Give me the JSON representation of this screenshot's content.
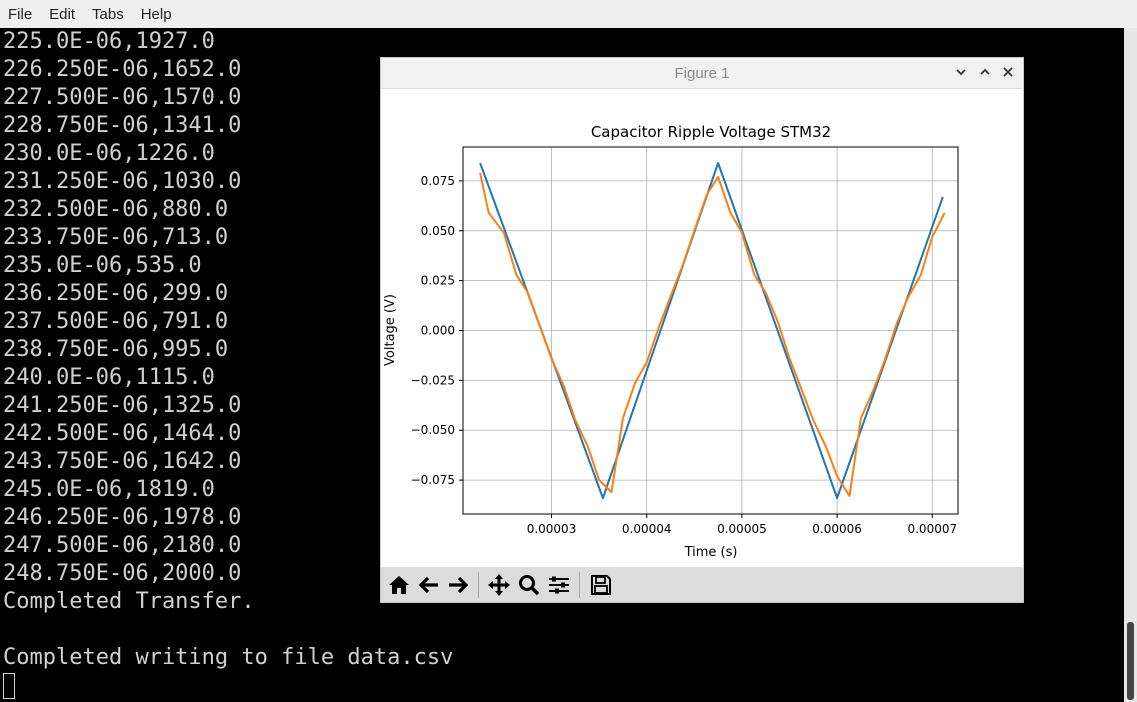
{
  "menubar": {
    "file": "File",
    "edit": "Edit",
    "tabs": "Tabs",
    "help": "Help"
  },
  "terminal": {
    "lines": [
      "225.0E-06,1927.0",
      "226.250E-06,1652.0",
      "227.500E-06,1570.0",
      "228.750E-06,1341.0",
      "230.0E-06,1226.0",
      "231.250E-06,1030.0",
      "232.500E-06,880.0",
      "233.750E-06,713.0",
      "235.0E-06,535.0",
      "236.250E-06,299.0",
      "237.500E-06,791.0",
      "238.750E-06,995.0",
      "240.0E-06,1115.0",
      "241.250E-06,1325.0",
      "242.500E-06,1464.0",
      "243.750E-06,1642.0",
      "245.0E-06,1819.0",
      "246.250E-06,1978.0",
      "247.500E-06,2180.0",
      "248.750E-06,2000.0",
      "Completed Transfer.",
      "",
      "Completed writing to file data.csv"
    ]
  },
  "figure": {
    "window_title": "Figure 1"
  },
  "chart_data": {
    "type": "line",
    "title": "Capacitor Ripple Voltage STM32",
    "xlabel": "Time (s)",
    "ylabel": "Voltage (V)",
    "xlim": [
      2.07e-05,
      7.27e-05
    ],
    "ylim": [
      -0.092,
      0.092
    ],
    "xticks": [
      3e-05,
      4e-05,
      5e-05,
      6e-05,
      7e-05
    ],
    "xtick_labels": [
      "0.00003",
      "0.00004",
      "0.00005",
      "0.00006",
      "0.00007"
    ],
    "yticks": [
      0.075,
      0.05,
      0.025,
      0.0,
      -0.025,
      -0.05,
      -0.075
    ],
    "ytick_labels": [
      "0.075",
      "0.050",
      "0.025",
      "0.000",
      "−0.025",
      "−0.050",
      "−0.075"
    ],
    "grid": true,
    "series": [
      {
        "color": "#1f77b4",
        "points": [
          [
            2.25e-05,
            0.084
          ],
          [
            3.54e-05,
            -0.084
          ],
          [
            4.75e-05,
            0.084
          ],
          [
            6e-05,
            -0.084
          ],
          [
            7.11e-05,
            0.067
          ]
        ]
      },
      {
        "color": "#ff7f0e",
        "points": [
          [
            2.25e-05,
            0.079
          ],
          [
            2.34e-05,
            0.059
          ],
          [
            2.5e-05,
            0.049
          ],
          [
            2.63e-05,
            0.028
          ],
          [
            2.75e-05,
            0.019
          ],
          [
            3e-05,
            -0.014
          ],
          [
            3.13e-05,
            -0.028
          ],
          [
            3.25e-05,
            -0.045
          ],
          [
            3.38e-05,
            -0.058
          ],
          [
            3.5e-05,
            -0.075
          ],
          [
            3.63e-05,
            -0.081
          ],
          [
            3.75e-05,
            -0.044
          ],
          [
            3.88e-05,
            -0.026
          ],
          [
            4e-05,
            -0.016
          ],
          [
            4.13e-05,
            0.002
          ],
          [
            4.25e-05,
            0.017
          ],
          [
            4.38e-05,
            0.033
          ],
          [
            4.5e-05,
            0.05
          ],
          [
            4.63e-05,
            0.068
          ],
          [
            4.75e-05,
            0.077
          ],
          [
            4.88e-05,
            0.059
          ],
          [
            5e-05,
            0.049
          ],
          [
            5.13e-05,
            0.028
          ],
          [
            5.25e-05,
            0.019
          ],
          [
            5.38e-05,
            0.004
          ],
          [
            5.5e-05,
            -0.014
          ],
          [
            5.63e-05,
            -0.03
          ],
          [
            5.75e-05,
            -0.045
          ],
          [
            5.88e-05,
            -0.058
          ],
          [
            6e-05,
            -0.073
          ],
          [
            6.13e-05,
            -0.083
          ],
          [
            6.25e-05,
            -0.044
          ],
          [
            6.38e-05,
            -0.03
          ],
          [
            6.5e-05,
            -0.015
          ],
          [
            6.63e-05,
            0.004
          ],
          [
            6.75e-05,
            0.017
          ],
          [
            6.88e-05,
            0.028
          ],
          [
            7e-05,
            0.047
          ],
          [
            7.13e-05,
            0.059
          ]
        ]
      }
    ]
  },
  "toolbar": {
    "buttons": [
      "home-icon",
      "back-arrow-icon",
      "forward-arrow-icon",
      "pan-icon",
      "zoom-icon",
      "configure-subplots-icon",
      "save-icon"
    ]
  }
}
